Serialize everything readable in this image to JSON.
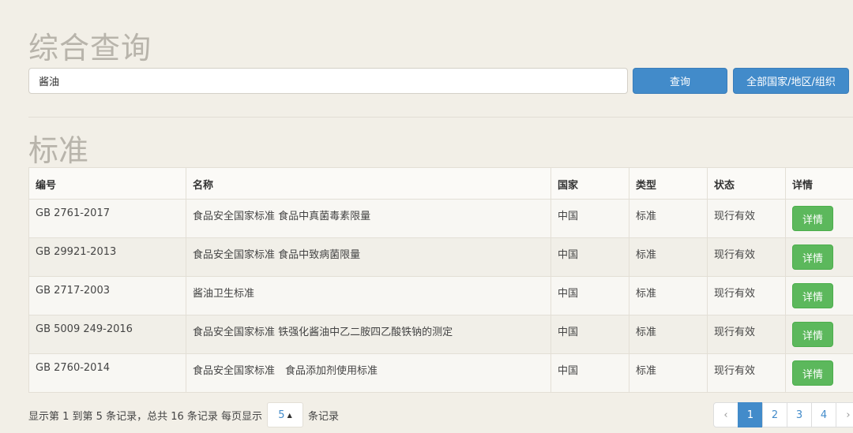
{
  "page_title": "综合查询",
  "search": {
    "value": "酱油",
    "query_button": "查询",
    "scope_button": "全部国家/地区/组织"
  },
  "section_title": "标准",
  "table": {
    "headers": [
      "编号",
      "名称",
      "国家",
      "类型",
      "状态",
      "详情"
    ],
    "rows": [
      {
        "number": "GB 2761-2017",
        "name": "食品安全国家标准 食品中真菌毒素限量",
        "country": "中国",
        "type": "标准",
        "status": "现行有效",
        "detail": "详情"
      },
      {
        "number": "GB 29921-2013",
        "name": "食品安全国家标准 食品中致病菌限量",
        "country": "中国",
        "type": "标准",
        "status": "现行有效",
        "detail": "详情"
      },
      {
        "number": "GB 2717-2003",
        "name": "酱油卫生标准",
        "country": "中国",
        "type": "标准",
        "status": "现行有效",
        "detail": "详情"
      },
      {
        "number": "GB 5009 249-2016",
        "name": "食品安全国家标准 铁强化酱油中乙二胺四乙酸铁钠的测定",
        "country": "中国",
        "type": "标准",
        "status": "现行有效",
        "detail": "详情"
      },
      {
        "number": "GB 2760-2014",
        "name": "食品安全国家标准　食品添加剂使用标准",
        "country": "中国",
        "type": "标准",
        "status": "现行有效",
        "detail": "详情"
      }
    ]
  },
  "footer": {
    "summary": "显示第 1 到第 5 条记录，总共 16 条记录 每页显示",
    "page_size": "5",
    "suffix": "条记录"
  },
  "pagination": {
    "prev": "‹",
    "pages": [
      "1",
      "2",
      "3",
      "4"
    ],
    "next": "›",
    "active": "1"
  },
  "colors": {
    "primary": "#428bca",
    "success": "#5cb85c",
    "background": "#f2efe7"
  }
}
